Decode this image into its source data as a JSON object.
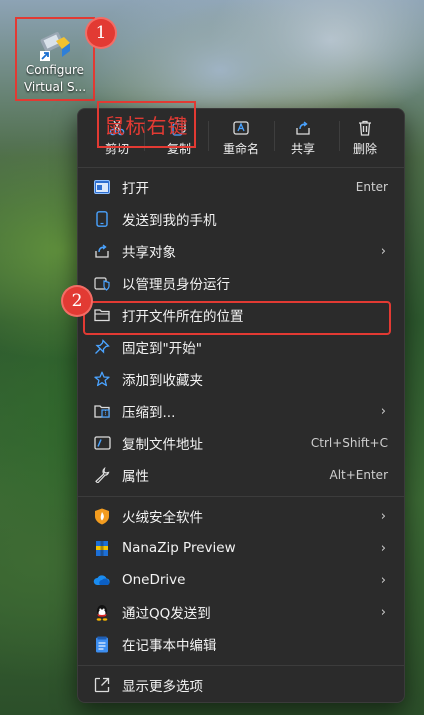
{
  "desktop_icon": {
    "label_line1": "Configure",
    "label_line2": "Virtual S..."
  },
  "annotations": {
    "step1": "1",
    "step2": "2",
    "right_click_note": "鼠标右键"
  },
  "toolbar": {
    "cut": "剪切",
    "copy": "复制",
    "rename": "重命名",
    "share": "共享",
    "delete": "删除"
  },
  "menu": {
    "items": [
      {
        "label": "打开",
        "accel": "Enter",
        "icon": "open-app-icon"
      },
      {
        "label": "发送到我的手机",
        "icon": "phone-icon"
      },
      {
        "label": "共享对象",
        "icon": "share-icon",
        "submenu": "›"
      },
      {
        "label": "以管理员身份运行",
        "icon": "admin-shield-icon"
      },
      {
        "label": "打开文件所在的位置",
        "icon": "folder-icon"
      },
      {
        "label": "固定到\"开始\"",
        "icon": "pin-icon"
      },
      {
        "label": "添加到收藏夹",
        "icon": "star-icon"
      },
      {
        "label": "压缩到...",
        "icon": "zip-icon",
        "submenu": "›"
      },
      {
        "label": "复制文件地址",
        "accel": "Ctrl+Shift+C",
        "icon": "copy-path-icon"
      },
      {
        "label": "属性",
        "accel": "Alt+Enter",
        "icon": "wrench-icon"
      },
      {
        "label": "火绒安全软件",
        "icon": "huorong-icon",
        "submenu": "›"
      },
      {
        "label": "NanaZip Preview",
        "icon": "nanazip-icon",
        "submenu": "›"
      },
      {
        "label": "OneDrive",
        "icon": "onedrive-icon",
        "submenu": "›"
      },
      {
        "label": "通过QQ发送到",
        "icon": "qq-icon",
        "submenu": "›"
      },
      {
        "label": "在记事本中编辑",
        "icon": "notepad-icon"
      },
      {
        "label": "显示更多选项",
        "icon": "more-options-icon"
      }
    ]
  },
  "colors": {
    "menu_bg": "#2b2b2b",
    "accent_red": "#e23a33",
    "icon_blue": "#4aa3ff"
  }
}
